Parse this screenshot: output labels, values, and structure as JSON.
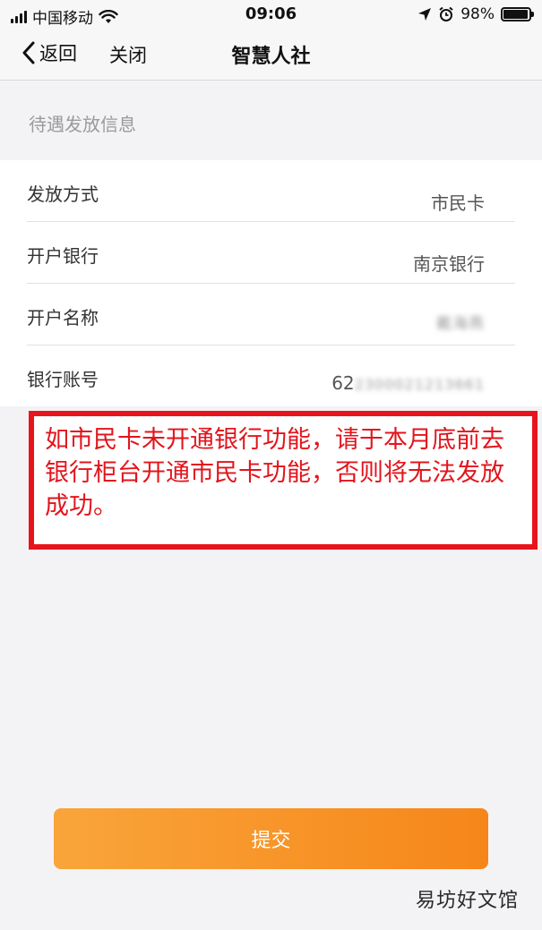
{
  "status_bar": {
    "carrier": "中国移动",
    "time": "09:06",
    "battery_percent": "98%",
    "battery_level": 0.98
  },
  "nav": {
    "back_label": "返回",
    "close_label": "关闭",
    "title": "智慧人社"
  },
  "section": {
    "header": "待遇发放信息"
  },
  "rows": [
    {
      "label": "发放方式",
      "value": "市民卡"
    },
    {
      "label": "开户银行",
      "value": "南京银行"
    },
    {
      "label": "开户名称",
      "value": "戴海燕"
    },
    {
      "label": "银行账号",
      "value_prefix": "62",
      "value_masked": "2300021213661"
    }
  ],
  "notice": {
    "text": "如市民卡未开通银行功能，请于本月底前去银行柜台开通市民卡功能，否则将无法发放成功。"
  },
  "submit": {
    "label": "提交"
  },
  "watermark": {
    "text": "易坊好文馆"
  },
  "colors": {
    "accent_orange": "#f6861a",
    "notice_red": "#e3141c"
  }
}
